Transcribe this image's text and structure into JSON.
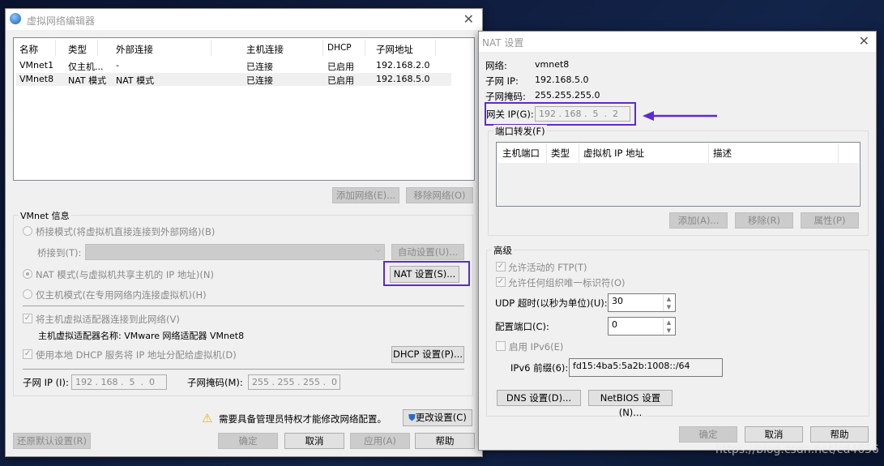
{
  "left": {
    "title": "虚拟网络编辑器",
    "columns": [
      "名称",
      "类型",
      "外部连接",
      "主机连接",
      "DHCP",
      "子网地址"
    ],
    "rows": [
      [
        "VMnet1",
        "仅主机...",
        "-",
        "已连接",
        "已启用",
        "192.168.2.0"
      ],
      [
        "VMnet8",
        "NAT 模式",
        "NAT 模式",
        "已连接",
        "已启用",
        "192.168.5.0"
      ]
    ],
    "add_network": "添加网络(E)...",
    "remove_network": "移除网络(O)",
    "group_label": "VMnet 信息",
    "bridge_mode": "桥接模式(将虚拟机直接连接到外部网络)(B)",
    "bridge_to": "桥接到(T):",
    "auto_settings": "自动设置(U)...",
    "nat_mode": "NAT 模式(与虚拟机共享主机的 IP 地址)(N)",
    "nat_settings": "NAT 设置(S)...",
    "host_only": "仅主机模式(在专用网络内连接虚拟机)(H)",
    "connect_adapter": "将主机虚拟适配器连接到此网络(V)",
    "adapter_name": "主机虚拟适配器名称: VMware 网络适配器 VMnet8",
    "use_dhcp": "使用本地 DHCP 服务将 IP 地址分配给虚拟机(D)",
    "dhcp_settings": "DHCP 设置(P)...",
    "subnet_ip_label": "子网 IP (I):",
    "subnet_ip": "192 . 168 .  5  .  0",
    "subnet_mask_label": "子网掩码(M):",
    "subnet_mask": "255 . 255 . 255 .  0",
    "warning": "需要具备管理员特权才能修改网络配置。",
    "change_settings": "更改设置(C)",
    "restore": "还原默认设置(R)",
    "ok": "确定",
    "cancel": "取消",
    "apply": "应用(A)",
    "help": "帮助"
  },
  "right": {
    "title": "NAT 设置",
    "network_label": "网络:",
    "network": "vmnet8",
    "subnet_ip_label": "子网 IP:",
    "subnet_ip": "192.168.5.0",
    "subnet_mask_label": "子网掩码:",
    "subnet_mask": "255.255.255.0",
    "gateway_label": "网关 IP(G):",
    "gateway": "192 . 168 .  5  .  2",
    "port_forward_label": "端口转发(F)",
    "pf_columns": [
      "主机端口",
      "类型",
      "虚拟机 IP 地址",
      "描述"
    ],
    "add": "添加(A)...",
    "remove": "移除(R)",
    "properties": "属性(P)",
    "advanced_label": "高级",
    "allow_ftp": "允许活动的 FTP(T)",
    "allow_oui": "允许任何组织唯一标识符(O)",
    "udp_label": "UDP 超时(以秒为单位)(U):",
    "udp": "30",
    "config_port_label": "配置端口(C):",
    "config_port": "0",
    "ipv6_enable": "启用 IPv6(E)",
    "ipv6_prefix_label": "IPv6 前缀(6):",
    "ipv6_prefix": "fd15:4ba5:5a2b:1008::/64",
    "dns": "DNS 设置(D)...",
    "netbios": "NetBIOS 设置(N)...",
    "ok": "确定",
    "cancel": "取消",
    "help": "帮助"
  },
  "watermark": "https://blog.csdn.net/cd4656",
  "colors": {
    "highlight": "#5b2bd0"
  }
}
